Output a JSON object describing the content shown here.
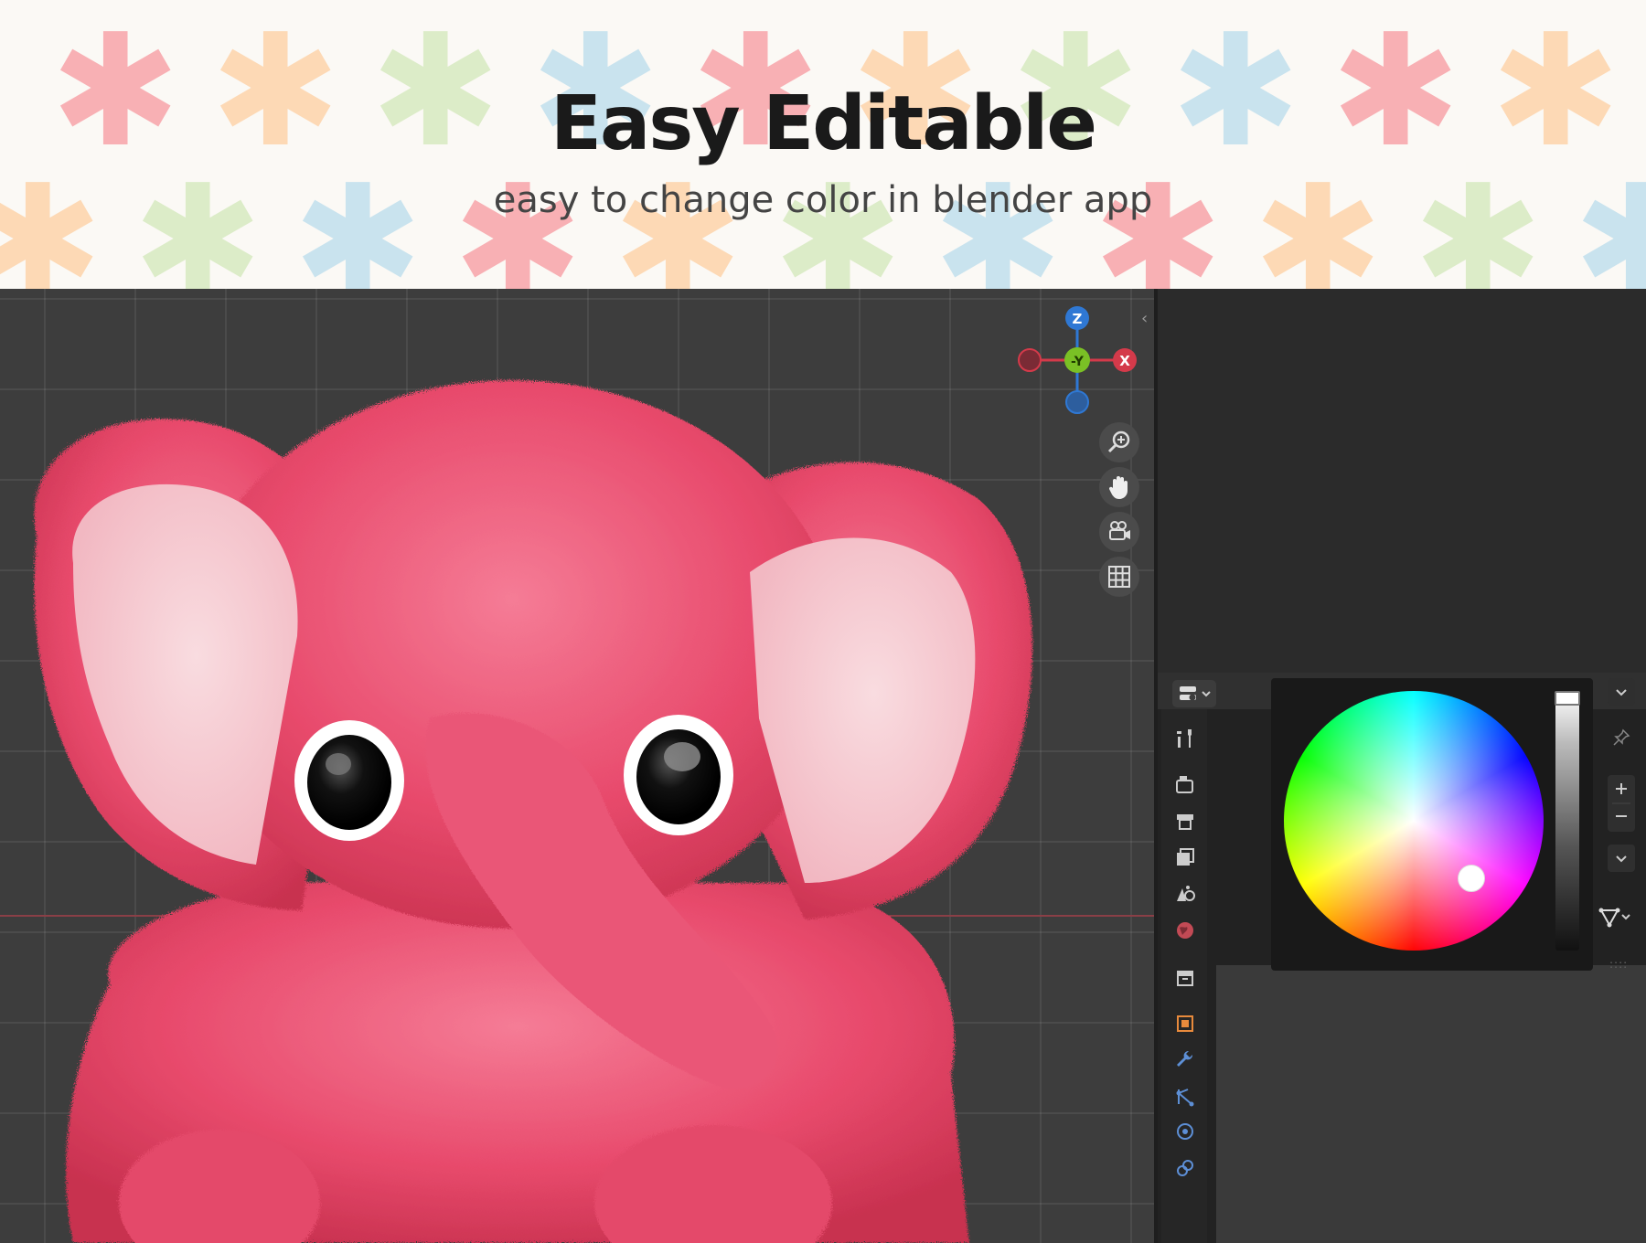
{
  "banner": {
    "title": "Easy Editable",
    "subtitle": "easy to change color in blender app",
    "asterisk_glyph": "✱",
    "asterisk_colors": [
      "#f8b0b4",
      "#fdd9b5",
      "#dcecc8",
      "#c9e3ee"
    ]
  },
  "viewport": {
    "gizmo": {
      "z_label": "Z",
      "y_label": "-Y",
      "x_label": "X"
    },
    "nav_icons": [
      "zoom-icon",
      "hand-pan-icon",
      "camera-icon",
      "grid-icon"
    ]
  },
  "properties": {
    "tabs": [
      "tool-icon",
      "render-icon",
      "output-icon",
      "view-layer-icon",
      "scene-icon",
      "world-icon",
      "collection-icon",
      "object-icon",
      "modifier-icon",
      "particles-icon",
      "physics-icon",
      "constraints-icon"
    ],
    "color_wheel": {
      "hue_deg": 315,
      "saturation": 0.65,
      "value": 1.0
    }
  },
  "colors": {
    "viewport_bg": "#3d3d3d",
    "panel_bg": "#222222",
    "z_axis": "#2f78d4",
    "y_axis": "#7ac025",
    "x_axis": "#d43a4a"
  }
}
